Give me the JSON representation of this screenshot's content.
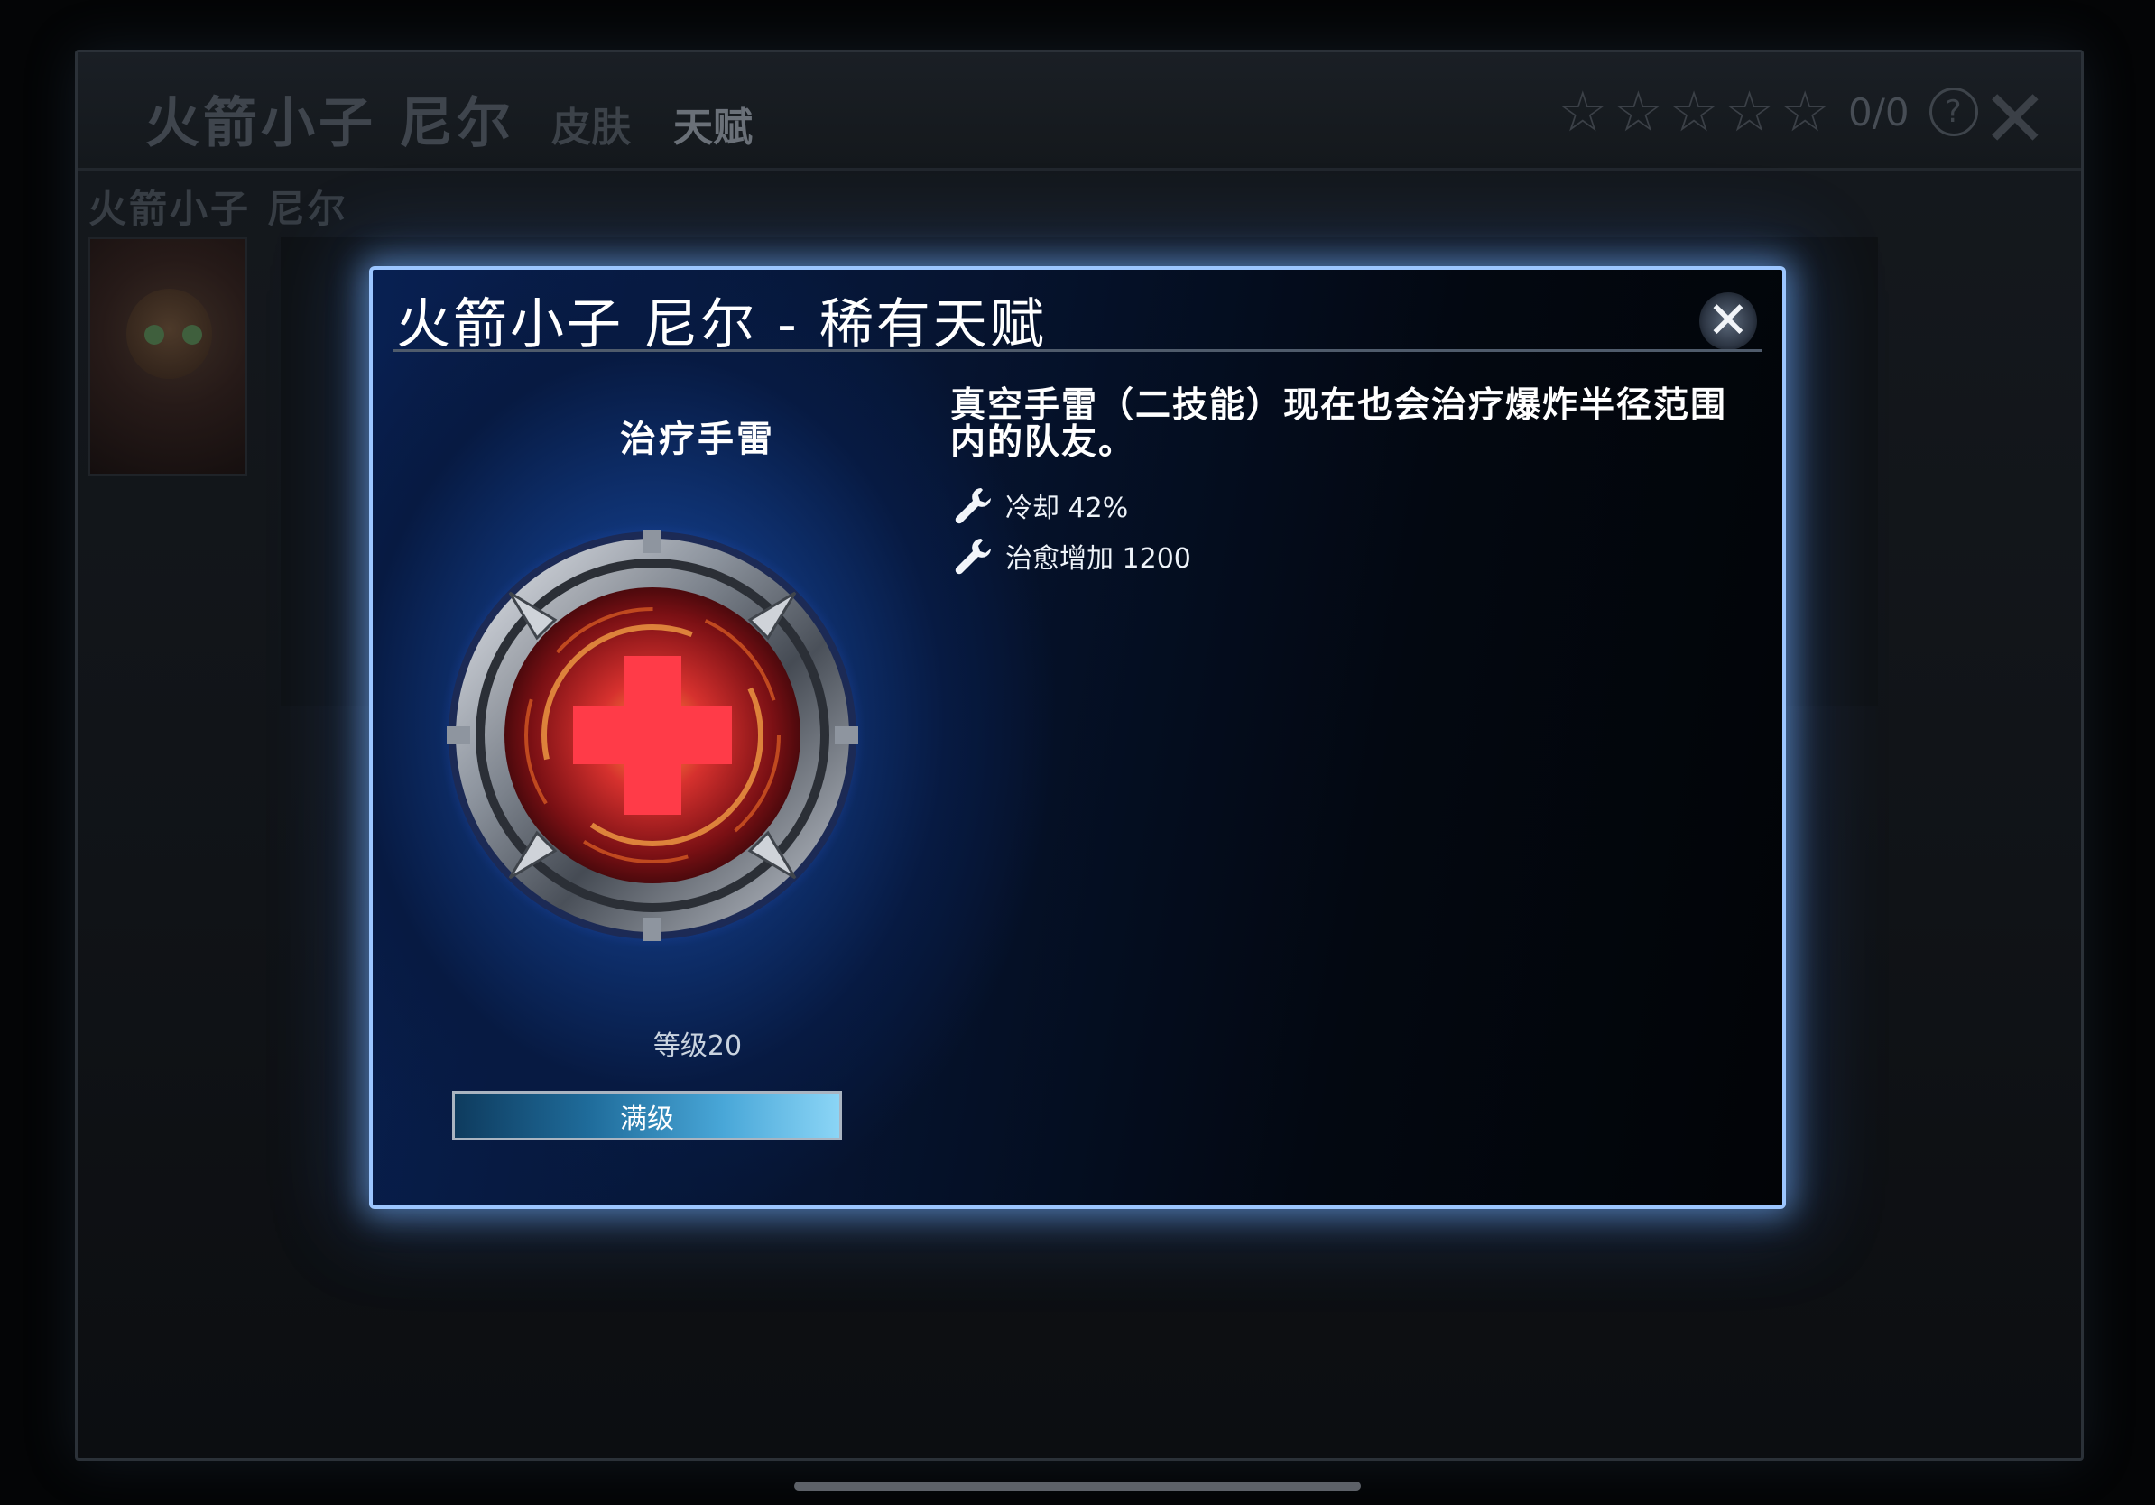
{
  "background": {
    "hero_title": "火箭小子 尼尔",
    "tabs": [
      "皮肤",
      "天赋"
    ],
    "active_tab": "天赋",
    "rating": {
      "stars_total": 5,
      "stars_filled": 0,
      "count_text": "0/0"
    },
    "help_glyph": "?",
    "close_glyph": "✕",
    "hero_subtitle": "火箭小子 尼尔"
  },
  "modal": {
    "title": "火箭小子 尼尔 - 稀有天赋",
    "close_glyph": "✕",
    "talent_name": "治疗手雷",
    "talent_icon": "healing-grenade-icon",
    "description": "真空手雷（二技能）现在也会治疗爆炸半径范围内的队友。",
    "stats": [
      {
        "icon": "wrench-icon",
        "text": "冷却 42%"
      },
      {
        "icon": "wrench-icon",
        "text": "治愈增加 1200"
      }
    ],
    "level_text": "等级20",
    "progress_label": "满级",
    "progress_fraction": 1.0
  },
  "colors": {
    "modal_border": "#9cc6ff",
    "modal_glow": "#78b4ff",
    "progress_fill": "#49a7d8",
    "icon_core": "#d6312e"
  }
}
